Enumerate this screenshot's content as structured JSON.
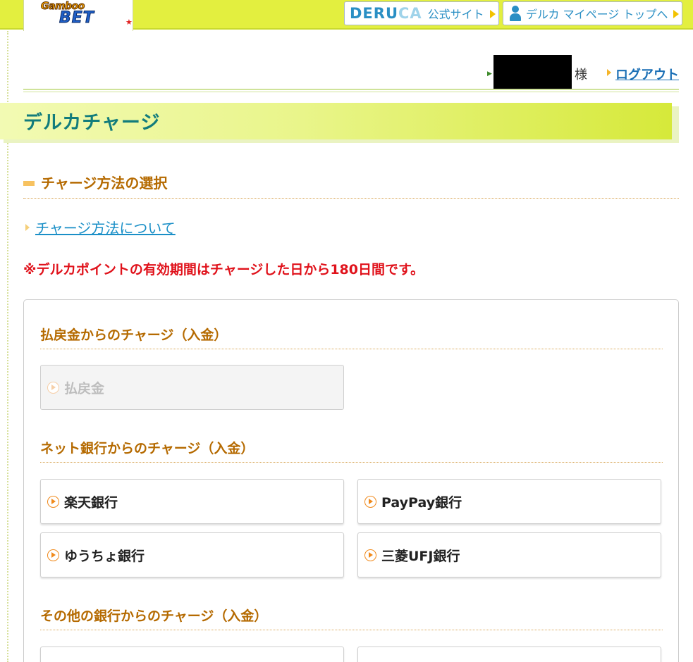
{
  "header": {
    "logo": {
      "top": "Gamboo",
      "bottom": "BET"
    },
    "deruca_link": {
      "brand": "DERUCA",
      "label": "公式サイト"
    },
    "mypage_link": {
      "label": "デルカ マイページ トップへ"
    }
  },
  "user": {
    "suffix": "様",
    "logout_label": "ログアウト"
  },
  "page": {
    "title": "デルカチャージ"
  },
  "section": {
    "title": "チャージ方法の選択",
    "about_link": "チャージ方法について",
    "notice": "※デルカポイントの有効期間はチャージした日から180日間です。"
  },
  "groups": [
    {
      "title": "払戻金からのチャージ（入金）",
      "options": [
        {
          "label": "払戻金",
          "enabled": false
        }
      ]
    },
    {
      "title": "ネット銀行からのチャージ（入金）",
      "options": [
        {
          "label": "楽天銀行",
          "enabled": true
        },
        {
          "label": "PayPay銀行",
          "enabled": true
        },
        {
          "label": "ゆうちょ銀行",
          "enabled": true
        },
        {
          "label": "三菱UFJ銀行",
          "enabled": true
        }
      ]
    },
    {
      "title": "その他の銀行からのチャージ（入金）",
      "options": []
    }
  ],
  "colors": {
    "topbar": "#e3ef3f",
    "title_text": "#127c7c",
    "section_heading": "#b56a00",
    "notice": "#e0121b",
    "link": "#1a8fc7",
    "option_arrow": "#f08a1c"
  }
}
